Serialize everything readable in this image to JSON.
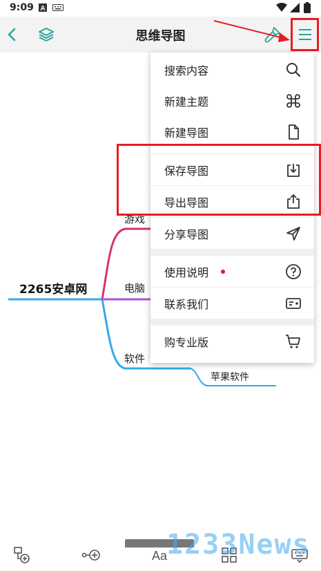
{
  "status_bar": {
    "time": "9:09",
    "icons": [
      "notification-a-icon",
      "keyboard-icon",
      "wifi-icon",
      "signal-icon",
      "battery-icon"
    ]
  },
  "toolbar": {
    "title": "思维导图",
    "back_icon": "chevron-left-icon",
    "layers_icon": "layers-icon",
    "brush_icon": "brush-icon",
    "menu_icon": "hamburger-menu-icon"
  },
  "mindmap": {
    "root": "2265安卓网",
    "branches": [
      {
        "label": "游戏",
        "color": "#d6336c"
      },
      {
        "label": "电脑",
        "color": "#b04fd6"
      },
      {
        "label": "软件",
        "color": "#35a9ea"
      }
    ],
    "sub_branches": [
      {
        "label": "苹果软件",
        "color": "#35a9ea"
      }
    ]
  },
  "menu": {
    "items": [
      {
        "label": "搜索内容",
        "icon": "search-icon"
      },
      {
        "label": "新建主题",
        "icon": "command-icon"
      },
      {
        "label": "新建导图",
        "icon": "file-icon"
      },
      {
        "label": "保存导图",
        "icon": "download-icon"
      },
      {
        "label": "导出导图",
        "icon": "share-upload-icon"
      },
      {
        "label": "分享导图",
        "icon": "send-icon"
      },
      {
        "label": "使用说明",
        "icon": "help-circle-icon",
        "badge": true
      },
      {
        "label": "联系我们",
        "icon": "contact-card-icon"
      },
      {
        "label": "购专业版",
        "icon": "cart-icon"
      }
    ]
  },
  "bottom_bar": {
    "buttons": [
      "add-topic-icon",
      "add-child-icon",
      "font-icon",
      "layout-icon",
      "keyboard-icon"
    ]
  },
  "watermark": "1233News",
  "colors": {
    "accent": "#26a69a",
    "annotation_red": "#e51c23",
    "toolbar_bg": "#f3f3f3"
  }
}
